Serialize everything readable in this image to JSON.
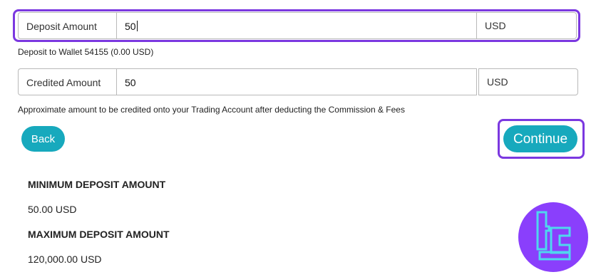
{
  "deposit": {
    "label": "Deposit Amount",
    "value": "50",
    "unit": "USD",
    "wallet_note": "Deposit to Wallet 54155 (0.00 USD)"
  },
  "credited": {
    "label": "Credited Amount",
    "value": "50",
    "unit": "USD",
    "note": "Approximate amount to be credited onto your Trading Account after deducting the Commission & Fees"
  },
  "buttons": {
    "back": "Back",
    "continue": "Continue"
  },
  "limits": {
    "min_heading": "MINIMUM DEPOSIT AMOUNT",
    "min_value": "50.00 USD",
    "max_heading": "MAXIMUM DEPOSIT AMOUNT",
    "max_value": "120,000.00 USD"
  },
  "colors": {
    "accent": "#17a9bd",
    "highlight": "#7b38e0",
    "logo_bg": "#8a3ffc",
    "logo_mark": "#4fd7ee"
  },
  "icons": {
    "logo": "tc-brand-logo"
  }
}
